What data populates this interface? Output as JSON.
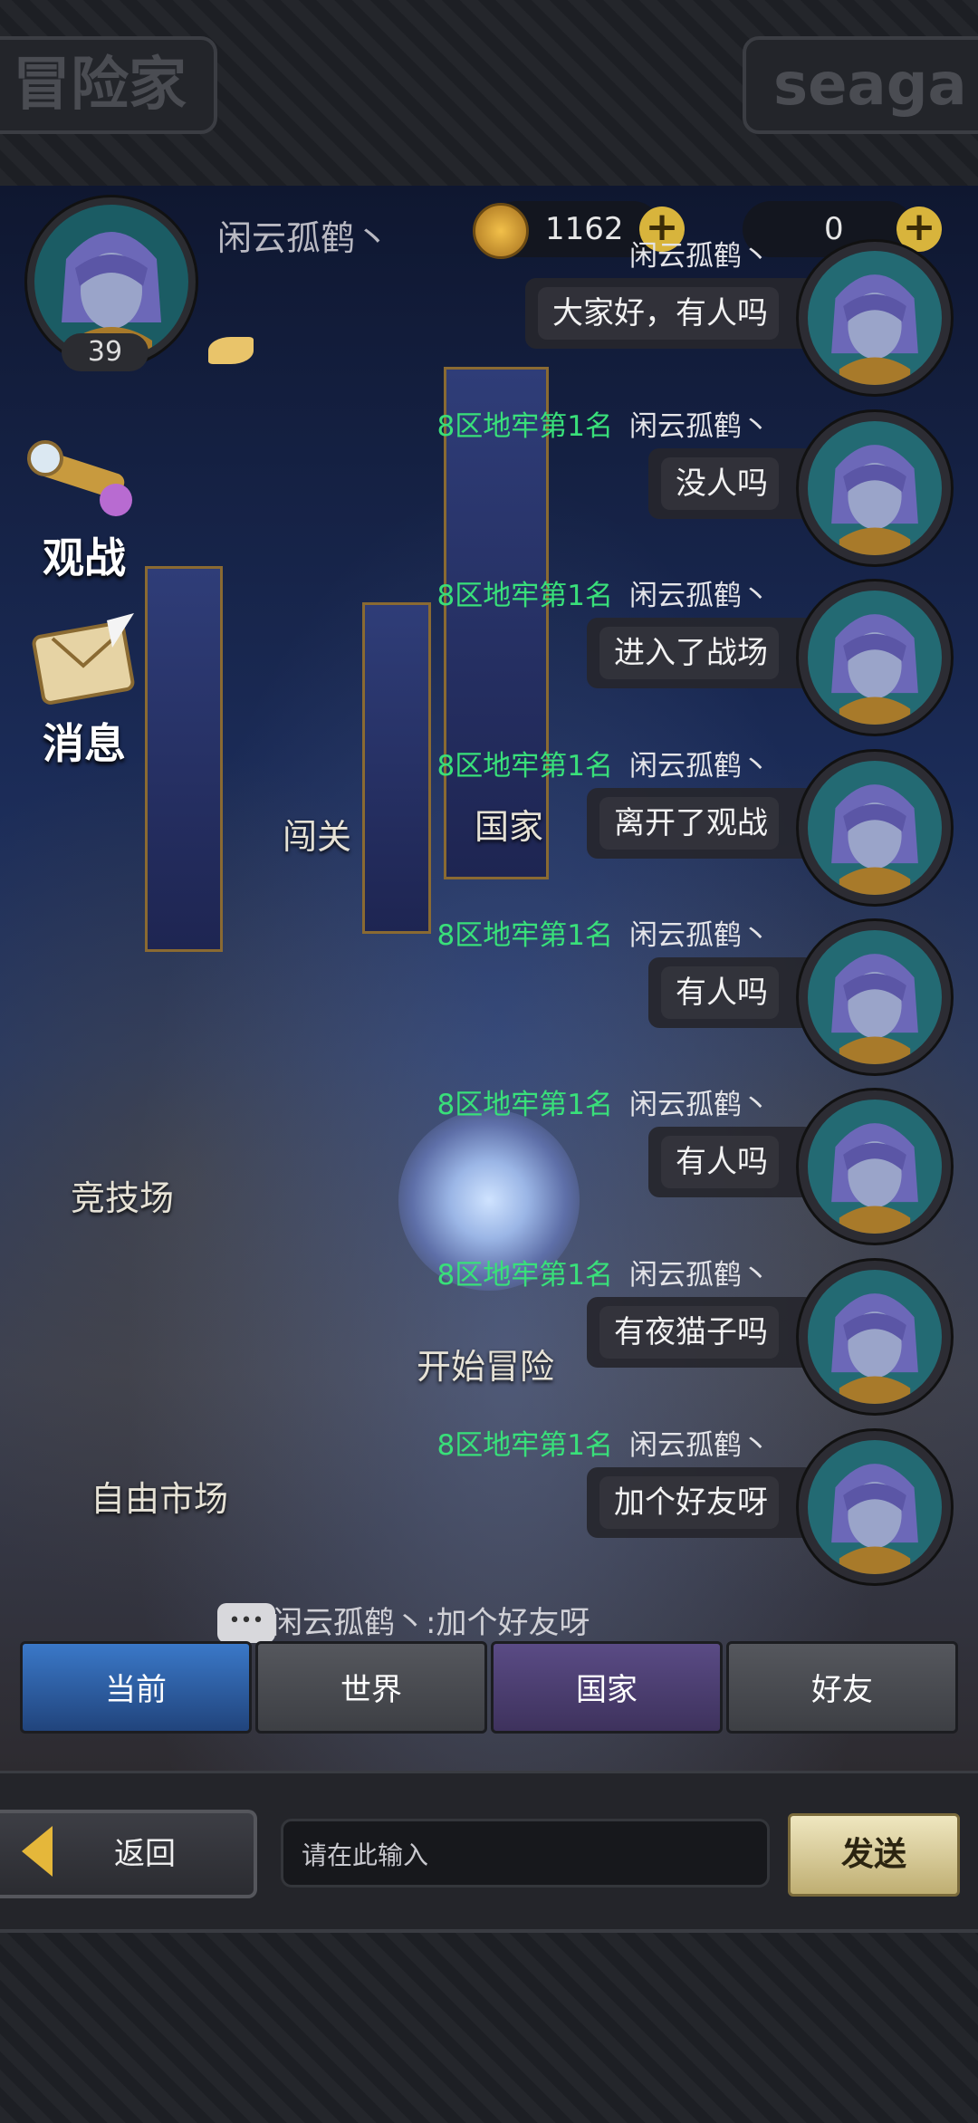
{
  "header": {
    "player_name": "闲云孤鹤丶",
    "level": "39",
    "gold": "1162",
    "shells": "0",
    "frame_left_text": "冒险家",
    "frame_right_text": "seaga"
  },
  "side_menu": [
    {
      "label": "观战",
      "icon": "telescope-icon"
    },
    {
      "label": "消息",
      "icon": "letter-icon"
    }
  ],
  "map_labels": {
    "gate": "闯关",
    "country": "国家",
    "arena": "竞技场",
    "start": "开始冒险",
    "market": "自由市场"
  },
  "chat": [
    {
      "tag": "",
      "name": "闲云孤鹤丶",
      "text": "大家好，有人吗"
    },
    {
      "tag": "8区地牢第1名",
      "name": "闲云孤鹤丶",
      "text": "没人吗"
    },
    {
      "tag": "8区地牢第1名",
      "name": "闲云孤鹤丶",
      "text": "进入了战场"
    },
    {
      "tag": "8区地牢第1名",
      "name": "闲云孤鹤丶",
      "text": "离开了观战"
    },
    {
      "tag": "8区地牢第1名",
      "name": "闲云孤鹤丶",
      "text": "有人吗"
    },
    {
      "tag": "8区地牢第1名",
      "name": "闲云孤鹤丶",
      "text": "有人吗"
    },
    {
      "tag": "8区地牢第1名",
      "name": "闲云孤鹤丶",
      "text": "有夜猫子吗"
    },
    {
      "tag": "8区地牢第1名",
      "name": "闲云孤鹤丶",
      "text": "加个好友呀"
    }
  ],
  "ticker": {
    "text": "闲云孤鹤丶:加个好友呀"
  },
  "tabs": [
    {
      "label": "当前"
    },
    {
      "label": "世界"
    },
    {
      "label": "国家"
    },
    {
      "label": "好友"
    }
  ],
  "bottom": {
    "back_label": "返回",
    "input_placeholder": "请在此输入",
    "send_label": "发送"
  },
  "colors": {
    "rank_tag": "#39e07a",
    "tab_active": "#3a78c8",
    "tab_country": "#5a4b85",
    "send_button": "#e3d8a6"
  }
}
